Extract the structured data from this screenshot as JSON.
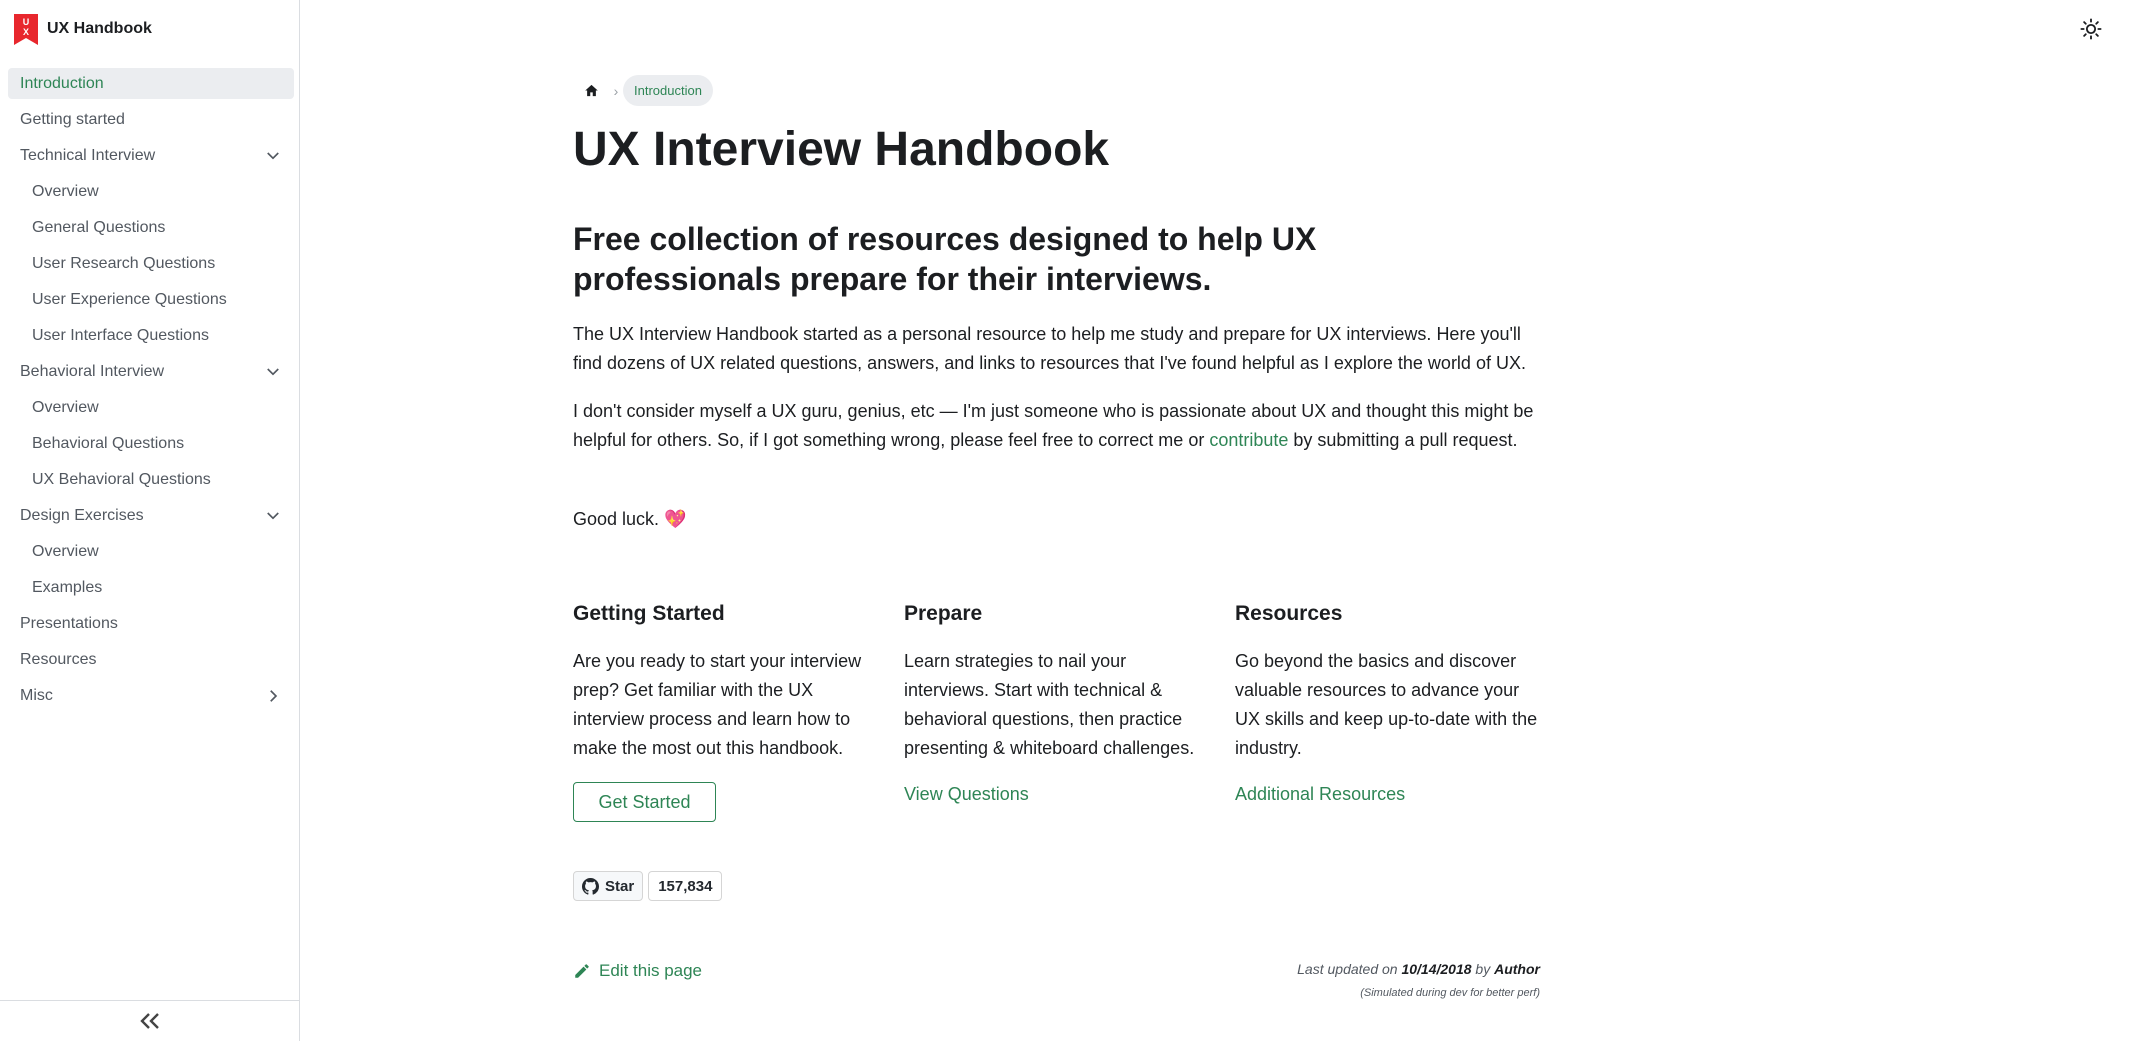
{
  "brand": {
    "title": "UX Handbook",
    "logo_letters": "UX",
    "accent": "#e8272d"
  },
  "sidebar": {
    "items": [
      {
        "label": "Introduction",
        "active": true
      },
      {
        "label": "Getting started"
      },
      {
        "label": "Technical Interview",
        "chevron": "down"
      },
      {
        "label": "Overview",
        "sub": true
      },
      {
        "label": "General Questions",
        "sub": true
      },
      {
        "label": "User Research Questions",
        "sub": true
      },
      {
        "label": "User Experience Questions",
        "sub": true
      },
      {
        "label": "User Interface Questions",
        "sub": true
      },
      {
        "label": "Behavioral Interview",
        "chevron": "down"
      },
      {
        "label": "Overview",
        "sub": true
      },
      {
        "label": "Behavioral Questions",
        "sub": true
      },
      {
        "label": "UX Behavioral Questions",
        "sub": true
      },
      {
        "label": "Design Exercises",
        "chevron": "down"
      },
      {
        "label": "Overview",
        "sub": true
      },
      {
        "label": "Examples",
        "sub": true
      },
      {
        "label": "Presentations"
      },
      {
        "label": "Resources"
      },
      {
        "label": "Misc",
        "chevron": "right"
      }
    ],
    "collapse_icon": "double-chevron-left-icon"
  },
  "breadcrumb": {
    "current": "Introduction"
  },
  "main": {
    "title": "UX Interview Handbook",
    "subtitle": "Free collection of resources designed to help UX professionals prepare for their interviews.",
    "para1": "The UX Interview Handbook started as a personal resource to help me study and prepare for UX interviews. Here you'll find dozens of UX related questions, answers, and links to resources that I've found helpful as I explore the world of UX.",
    "para2_before": "I don't consider myself a UX guru, genius, etc — I'm just someone who is passionate about UX and thought this might be helpful for others. So, if I got something wrong, please feel free to correct me or ",
    "para2_link": "contribute",
    "para2_after": " by submitting a pull request.",
    "para3": "Good luck. 💖"
  },
  "cards": [
    {
      "title": "Getting Started",
      "body": "Are you ready to start your interview prep? Get familiar with the UX interview process and learn how to make the most out this handbook.",
      "action": "Get Started"
    },
    {
      "title": "Prepare",
      "body": "Learn strategies to nail your interviews. Start with technical & behavioral questions, then practice presenting & whiteboard challenges.",
      "action": "View Questions"
    },
    {
      "title": "Resources",
      "body": "Go beyond the basics and discover valuable resources to advance your UX skills and keep up-to-date with the industry.",
      "action": "Additional Resources"
    }
  ],
  "github": {
    "star_label": "Star",
    "count": "157,834"
  },
  "footer": {
    "edit_label": "Edit this page",
    "updated_prefix": "Last updated on ",
    "updated_date": "10/14/2018",
    "updated_by": " by ",
    "updated_author": "Author",
    "simulated_note": "(Simulated during dev for better perf)"
  },
  "colors": {
    "link": "#2e8555",
    "active_bg": "#ebedf0",
    "text": "#1c1e21",
    "muted": "#525860"
  }
}
